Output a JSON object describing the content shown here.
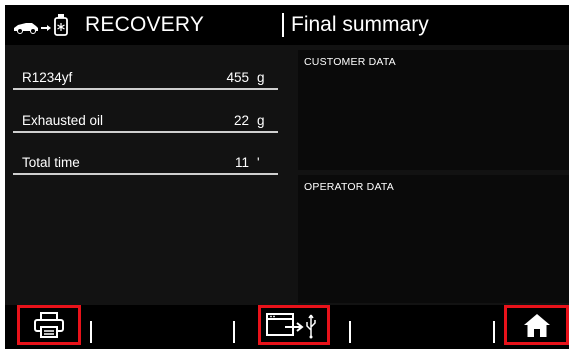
{
  "header": {
    "title": "RECOVERY",
    "subtitle": "Final summary"
  },
  "summary": {
    "rows": [
      {
        "name": "R1234yf",
        "value": "455",
        "unit": "g"
      },
      {
        "name": "Exhausted oil",
        "value": "22",
        "unit": "g"
      },
      {
        "name": "Total time",
        "value": "11",
        "unit": "'"
      }
    ]
  },
  "panels": {
    "customer_title": "CUSTOMER DATA",
    "operator_title": "OPERATOR DATA"
  },
  "footer": {
    "buttons": [
      {
        "name": "print-button",
        "icon": "printer-icon"
      },
      {
        "name": "usb-export-button",
        "icon": "usb-export-icon"
      },
      {
        "name": "home-button",
        "icon": "home-icon"
      }
    ]
  },
  "colors": {
    "background": "#121212",
    "highlight": "#e8121a",
    "text": "#ffffff"
  }
}
